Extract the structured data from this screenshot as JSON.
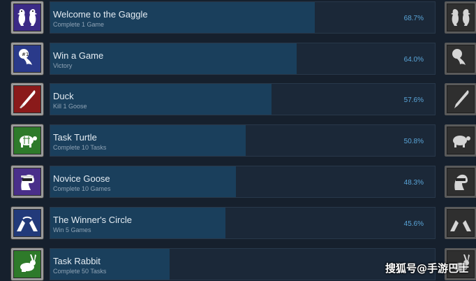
{
  "achievements": [
    {
      "title": "Welcome to the Gaggle",
      "description": "Complete 1 Game",
      "percent_label": "68.7%",
      "percent": 68.7,
      "icon": "two-geese-icon",
      "icon_bg": "#3b2a86",
      "icon_bg_locked": "#2f2f2f"
    },
    {
      "title": "Win a Game",
      "description": "Victory",
      "percent_label": "64.0%",
      "percent": 64.0,
      "icon": "ribbon-award-icon",
      "icon_bg": "#2a3a8a",
      "icon_bg_locked": "#2f2f2f"
    },
    {
      "title": "Duck",
      "description": "Kill 1 Goose",
      "percent_label": "57.6%",
      "percent": 57.6,
      "icon": "knife-icon",
      "icon_bg": "#8a1a1a",
      "icon_bg_locked": "#2f2f2f"
    },
    {
      "title": "Task Turtle",
      "description": "Complete 10 Tasks",
      "percent_label": "50.8%",
      "percent": 50.8,
      "icon": "turtle-icon",
      "icon_bg": "#2e7a2a",
      "icon_bg_locked": "#2f2f2f"
    },
    {
      "title": "Novice Goose",
      "description": "Complete 10 Games",
      "percent_label": "48.3%",
      "percent": 48.3,
      "icon": "goose-head-icon",
      "icon_bg": "#4a2f8a",
      "icon_bg_locked": "#2f2f2f"
    },
    {
      "title": "The Winner's Circle",
      "description": "Win 5 Games",
      "percent_label": "45.6%",
      "percent": 45.6,
      "icon": "hands-circle-icon",
      "icon_bg": "#223a7a",
      "icon_bg_locked": "#2f2f2f"
    },
    {
      "title": "Task Rabbit",
      "description": "Complete 50 Tasks",
      "percent_label": "",
      "percent": 31.0,
      "icon": "rabbit-icon",
      "icon_bg": "#2e7a2a",
      "icon_bg_locked": "#2f2f2f"
    }
  ],
  "watermark": {
    "text": "搜狐号@手游巴士"
  },
  "colors": {
    "page_bg": "#16202d",
    "bar_bg": "#1b2838",
    "bar_fill": "#1a3f5c",
    "title": "#e4ecf3",
    "description": "#8fa3b5",
    "percent": "#5aa5d8"
  }
}
